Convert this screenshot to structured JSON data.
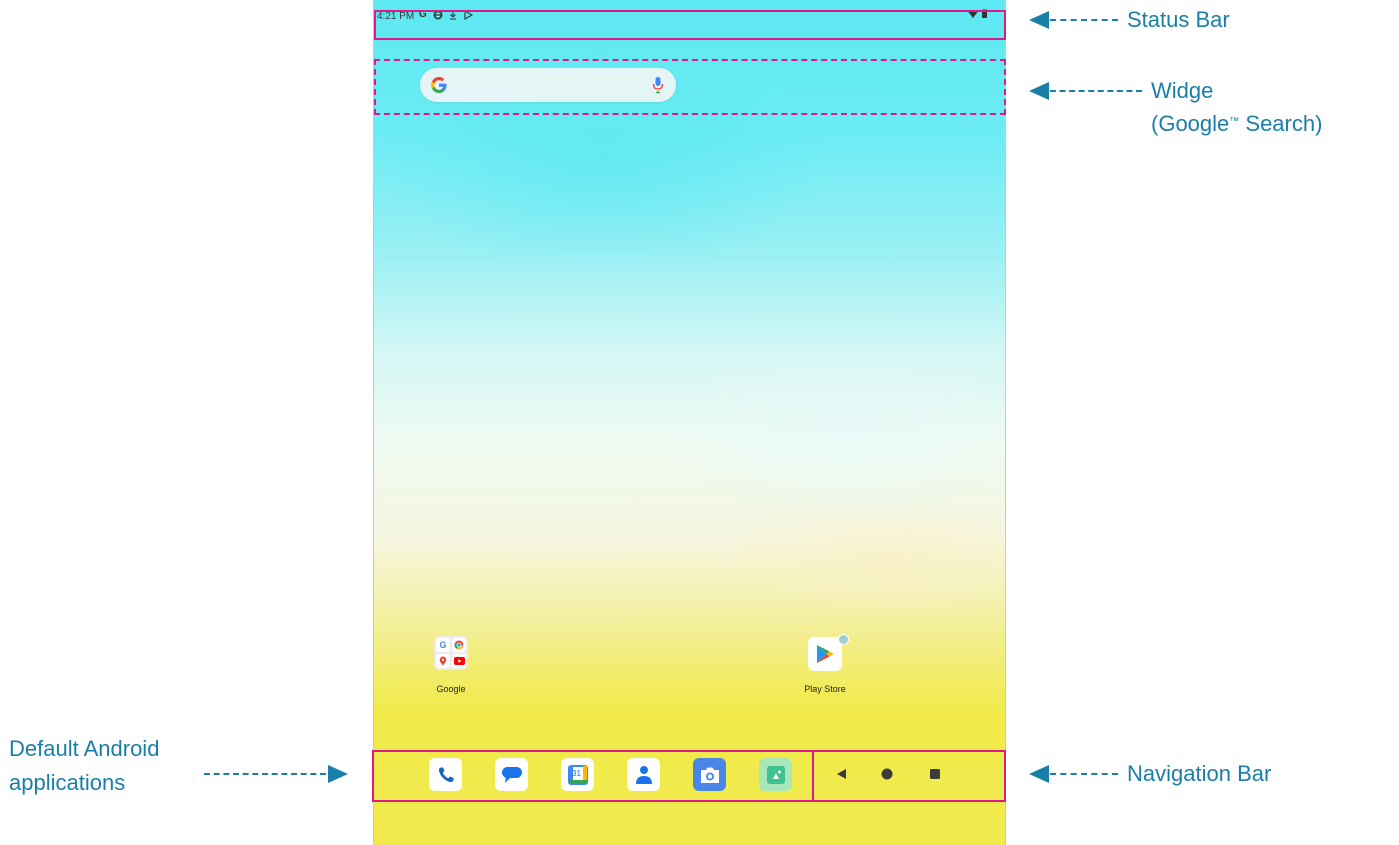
{
  "status_bar": {
    "time": "4:21 PM"
  },
  "search_widget": {
    "logo_letter": "G"
  },
  "home_apps": [
    {
      "label": "Google"
    },
    {
      "label": "Play Store"
    }
  ],
  "google_folder": {
    "letter": "G"
  },
  "dock_apps": [
    {
      "icon": "phone-icon"
    },
    {
      "icon": "messages-icon"
    },
    {
      "icon": "calendar-icon",
      "text": "31"
    },
    {
      "icon": "contacts-icon"
    },
    {
      "icon": "camera-icon"
    },
    {
      "icon": "gallery-icon"
    }
  ],
  "nav_buttons": [
    "back",
    "home",
    "recents"
  ],
  "annotations": {
    "status_bar": "Status Bar",
    "widget_line1": "Widge",
    "widget_line2_a": "(Google",
    "widget_tm": "™",
    "widget_line2_b": " Search)",
    "default_apps_line1": "Default Android",
    "default_apps_line2": "applications",
    "navigation_bar": "Navigation Bar"
  },
  "colors": {
    "highlight": "#e0198a",
    "annotation": "#1a7fa8"
  }
}
